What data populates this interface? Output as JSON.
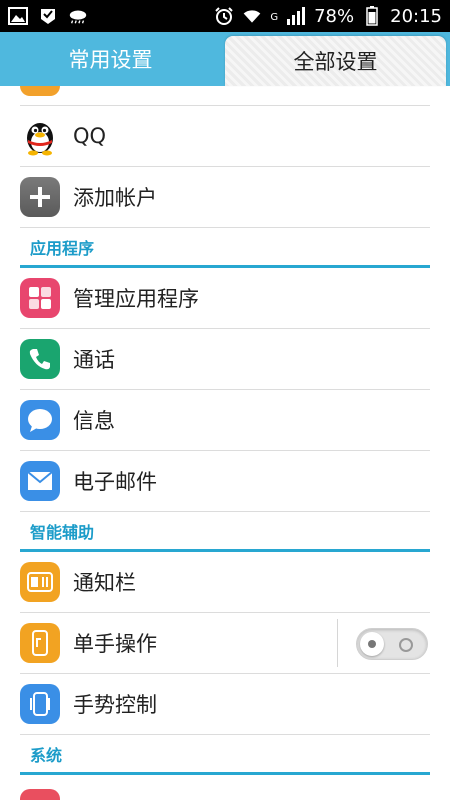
{
  "status_bar": {
    "network_label": "G",
    "battery": "78%",
    "time": "20:15"
  },
  "tabs": [
    {
      "label": "常用设置",
      "active": false
    },
    {
      "label": "全部设置",
      "active": true
    }
  ],
  "rows_top": [
    {
      "name": "qq",
      "label": "QQ",
      "icon": "qq-penguin-icon"
    },
    {
      "name": "add-account",
      "label": "添加帐户",
      "icon": "plus-icon"
    }
  ],
  "sections": {
    "apps": "应用程序",
    "assist": "智能辅助",
    "system": "系统"
  },
  "rows_apps": [
    {
      "name": "manage-apps",
      "label": "管理应用程序",
      "icon": "apps-grid-icon"
    },
    {
      "name": "phone",
      "label": "通话",
      "icon": "phone-icon"
    },
    {
      "name": "messages",
      "label": "信息",
      "icon": "chat-bubble-icon"
    },
    {
      "name": "email",
      "label": "电子邮件",
      "icon": "envelope-icon"
    }
  ],
  "rows_assist": [
    {
      "name": "notification-bar",
      "label": "通知栏",
      "icon": "notification-bar-icon"
    },
    {
      "name": "one-hand",
      "label": "单手操作",
      "icon": "one-hand-icon",
      "toggle": false
    },
    {
      "name": "gesture",
      "label": "手势控制",
      "icon": "gesture-icon"
    }
  ],
  "colors": {
    "tab_bar": "#4fb8de",
    "section_accent": "#28a7d1",
    "icon_manage_apps": "#e8466e",
    "icon_phone": "#1aa56f",
    "icon_messages": "#3a8fe6",
    "icon_email": "#3a8fe6",
    "icon_notification": "#f2a322",
    "icon_one_hand": "#f2a322",
    "icon_gesture": "#3a8fe6"
  }
}
